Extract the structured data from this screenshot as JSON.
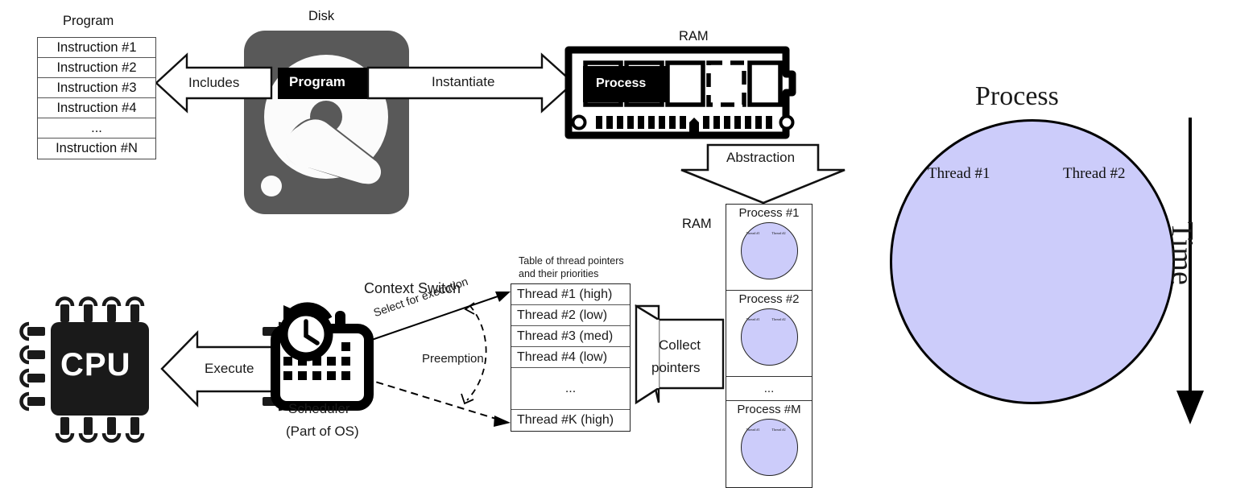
{
  "program": {
    "title": "Program",
    "instructions": [
      "Instruction #1",
      "Instruction #2",
      "Instruction #3",
      "Instruction #4",
      "...",
      "Instruction #N"
    ]
  },
  "disk": {
    "title": "Disk",
    "badge": "Program"
  },
  "ram": {
    "title": "RAM",
    "badge": "Process",
    "stack_label": "RAM"
  },
  "arrows": {
    "includes": "Includes",
    "instantiate": "Instantiate",
    "abstraction": "Abstraction",
    "execute": "Execute",
    "collect_pointers_line1": "Collect",
    "collect_pointers_line2": "pointers",
    "context_switch": "Context Switch",
    "select_for_execution": "Select for execution",
    "preemption": "Preemption"
  },
  "cpu": {
    "label": "CPU"
  },
  "scheduler": {
    "line1": "Scheduler",
    "line2": "(Part of OS)"
  },
  "thread_table": {
    "caption_line1": "Table of thread pointers",
    "caption_line2": "and their priorities",
    "rows": [
      "Thread #1 (high)",
      "Thread #2 (low)",
      "Thread #3 (med)",
      "Thread #4 (low)",
      "...",
      "Thread #K (high)"
    ]
  },
  "process_stack": {
    "cells": [
      "Process #1",
      "Process #2",
      "...",
      "Process #M"
    ],
    "mini_thread_1": "Thread #1",
    "mini_thread_2": "Thread #2"
  },
  "process_panel": {
    "title": "Process",
    "thread1": "Thread #1",
    "thread2": "Thread #2",
    "time_axis": "Time"
  },
  "colors": {
    "lavender": "#ccccfa",
    "disk_gray": "#595959",
    "black": "#000000",
    "outline": "#222222"
  }
}
